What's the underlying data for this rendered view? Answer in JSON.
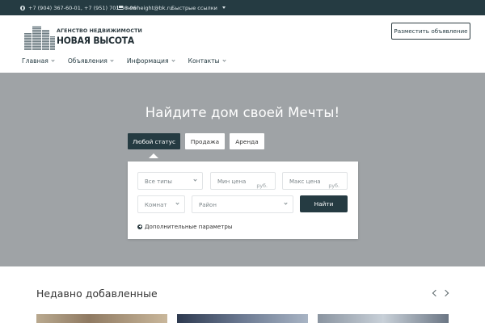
{
  "topbar": {
    "phones": "+7 (904) 367-60-01, +7 (951) 703-98-96",
    "email": "newheight@bk.ru",
    "quick_links": "Быстрые ссылки"
  },
  "header": {
    "logo_line1": "АГЕНСТВО НЕДВИЖИМОСТИ",
    "logo_line2": "НОВАЯ ВЫСОТА",
    "post_button": "Разместить объявление",
    "nav": [
      "Главная",
      "Объявления",
      "Информация",
      "Контакты"
    ]
  },
  "hero": {
    "title": "Найдите дом своей Мечты!",
    "tabs": [
      "Любой статус",
      "Продажа",
      "Аренда"
    ],
    "active_tab": "Любой статус",
    "fields": {
      "type": "Все типы",
      "min_price": "Мин цена",
      "max_price": "Макс цена",
      "currency": "руб.",
      "rooms": "Комнат",
      "district": "Район"
    },
    "search_button": "Найти",
    "more_params": "Дополнительные параметры"
  },
  "recent": {
    "title": "Недавно добавленные"
  },
  "colors": {
    "primary": "#253b42",
    "hero_bg": "#9fa3a6",
    "white": "#ffffff"
  }
}
